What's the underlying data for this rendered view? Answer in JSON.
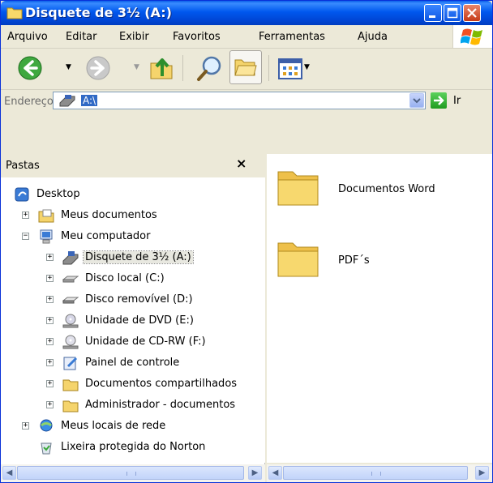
{
  "window": {
    "title": "Disquete de 3½ (A:)",
    "title_icon": "folder-window-icon",
    "buttons": {
      "minimize_icon": "minimize-icon",
      "maximize_icon": "maximize-icon",
      "close_icon": "close-icon"
    }
  },
  "menubar": {
    "items": [
      "Arquivo",
      "Editar",
      "Exibir",
      "Favoritos",
      "Ferramentas",
      "Ajuda"
    ]
  },
  "toolbar": {
    "buttons": [
      "back-icon",
      "forward-icon",
      "up-folder-icon",
      "search-icon",
      "folders-icon",
      "views-icon"
    ]
  },
  "address": {
    "label": "Endereço",
    "value": "A:\\",
    "go_label": "Ir"
  },
  "folders_pane": {
    "title": "Pastas",
    "close_symbol": "×",
    "tree": [
      {
        "label": "Desktop",
        "icon": "desktop-icon"
      },
      {
        "label": "Meus documentos",
        "icon": "my-documents-icon",
        "expander": "+"
      },
      {
        "label": "Meu computador",
        "icon": "my-computer-icon",
        "expander": "−"
      },
      {
        "label": "Disquete de 3½ (A:)",
        "icon": "floppy-drive-icon",
        "expander": "+",
        "selected": true
      },
      {
        "label": "Disco local (C:)",
        "icon": "hard-disk-icon",
        "expander": "+"
      },
      {
        "label": "Disco removível (D:)",
        "icon": "removable-disk-icon",
        "expander": "+"
      },
      {
        "label": "Unidade de DVD (E:)",
        "icon": "dvd-drive-icon",
        "expander": "+"
      },
      {
        "label": "Unidade de CD-RW (F:)",
        "icon": "cdrw-drive-icon",
        "expander": "+"
      },
      {
        "label": "Painel de controle",
        "icon": "control-panel-icon",
        "expander": "+"
      },
      {
        "label": "Documentos compartilhados",
        "icon": "folder-icon",
        "expander": "+"
      },
      {
        "label": "Administrador - documentos",
        "icon": "folder-icon",
        "expander": "+"
      },
      {
        "label": "Meus locais de rede",
        "icon": "network-places-icon",
        "expander": "+"
      },
      {
        "label": "Lixeira protegida do Norton",
        "icon": "recycle-bin-icon"
      }
    ]
  },
  "content": {
    "items": [
      {
        "label": "Documentos Word",
        "icon": "folder-icon"
      },
      {
        "label": "PDF´s",
        "icon": "folder-icon"
      }
    ]
  },
  "colors": {
    "titlebar": "#0058ee",
    "selection": "#316ac5",
    "folder": "#f5d46c"
  }
}
